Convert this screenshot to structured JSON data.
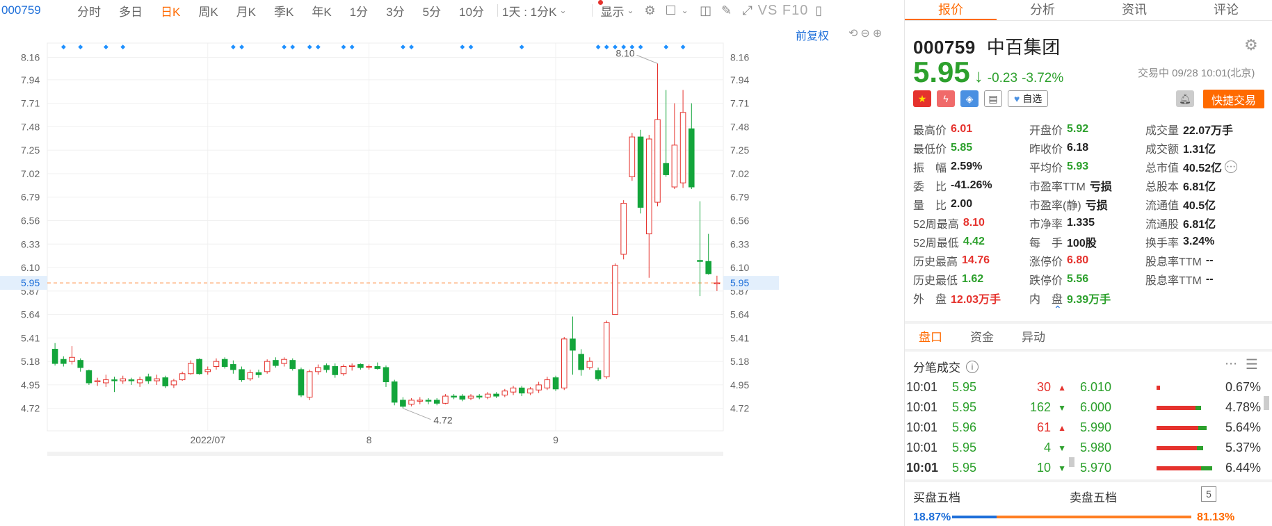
{
  "toolbar": {
    "code": "000759",
    "periods": [
      "分时",
      "多日",
      "日K",
      "周K",
      "月K",
      "季K",
      "年K",
      "1分",
      "3分",
      "5分",
      "10分"
    ],
    "active_period": "日K",
    "multi_period_select": "1天 : 1分K",
    "display_label": "显示",
    "f10_label": "VS F10"
  },
  "chart_header": {
    "adjust_label": "前复权"
  },
  "chart_data": {
    "type": "candlestick",
    "y_ticks": [
      "8.16",
      "7.94",
      "7.71",
      "7.48",
      "7.25",
      "7.02",
      "6.79",
      "6.56",
      "6.33",
      "6.10",
      "5.87",
      "5.64",
      "5.41",
      "5.18",
      "4.95",
      "4.72"
    ],
    "ylim": [
      4.5,
      8.3
    ],
    "x_labels": [
      {
        "label": "2022/07",
        "index": 18
      },
      {
        "label": "8",
        "index": 37
      },
      {
        "label": "9",
        "index": 59
      }
    ],
    "current_price": "5.95",
    "max_label": "8.10",
    "min_label": "4.72",
    "candles": [
      [
        5.3,
        5.16,
        5.36,
        5.14
      ],
      [
        5.2,
        5.16,
        5.23,
        5.13
      ],
      [
        5.18,
        5.22,
        5.33,
        5.15
      ],
      [
        5.19,
        5.12,
        5.21,
        5.08
      ],
      [
        5.09,
        4.97,
        5.1,
        4.95
      ],
      [
        4.98,
        4.99,
        5.02,
        4.94
      ],
      [
        4.97,
        5.0,
        5.05,
        4.93
      ],
      [
        5.0,
        4.99,
        5.03,
        4.88
      ],
      [
        4.99,
        5.01,
        5.04,
        4.96
      ],
      [
        5.0,
        4.99,
        5.02,
        4.95
      ],
      [
        4.97,
        5.0,
        5.03,
        4.93
      ],
      [
        5.03,
        4.99,
        5.06,
        4.96
      ],
      [
        4.99,
        5.01,
        5.05,
        4.95
      ],
      [
        5.02,
        4.94,
        5.04,
        4.92
      ],
      [
        4.95,
        4.99,
        5.01,
        4.92
      ],
      [
        5.0,
        5.06,
        5.08,
        4.99
      ],
      [
        5.06,
        5.16,
        5.19,
        5.05
      ],
      [
        5.2,
        5.06,
        5.21,
        5.05
      ],
      [
        5.08,
        5.1,
        5.13,
        5.05
      ],
      [
        5.13,
        5.18,
        5.21,
        5.1
      ],
      [
        5.2,
        5.13,
        5.22,
        5.11
      ],
      [
        5.15,
        5.1,
        5.19,
        5.06
      ],
      [
        5.1,
        5.0,
        5.13,
        4.98
      ],
      [
        5.01,
        5.07,
        5.1,
        4.99
      ],
      [
        5.07,
        5.05,
        5.1,
        5.02
      ],
      [
        5.08,
        5.18,
        5.2,
        5.06
      ],
      [
        5.19,
        5.14,
        5.22,
        5.12
      ],
      [
        5.16,
        5.2,
        5.22,
        5.13
      ],
      [
        5.19,
        5.11,
        5.21,
        5.09
      ],
      [
        5.1,
        4.85,
        5.12,
        4.83
      ],
      [
        4.83,
        5.08,
        5.1,
        4.8
      ],
      [
        5.08,
        5.12,
        5.15,
        5.05
      ],
      [
        5.14,
        5.1,
        5.16,
        5.07
      ],
      [
        5.13,
        5.05,
        5.16,
        5.02
      ],
      [
        5.06,
        5.13,
        5.15,
        5.04
      ],
      [
        5.13,
        5.14,
        5.16,
        5.09
      ],
      [
        5.15,
        5.12,
        5.16,
        5.1
      ],
      [
        5.13,
        5.13,
        5.15,
        5.1
      ],
      [
        5.13,
        5.11,
        5.17,
        5.1
      ],
      [
        5.12,
        4.98,
        5.14,
        4.93
      ],
      [
        4.98,
        4.78,
        5.0,
        4.75
      ],
      [
        4.8,
        4.74,
        4.83,
        4.72
      ],
      [
        4.76,
        4.8,
        4.82,
        4.74
      ],
      [
        4.79,
        4.8,
        4.83,
        4.76
      ],
      [
        4.8,
        4.79,
        4.82,
        4.76
      ],
      [
        4.8,
        4.77,
        4.82,
        4.75
      ],
      [
        4.77,
        4.84,
        4.86,
        4.76
      ],
      [
        4.84,
        4.83,
        4.86,
        4.81
      ],
      [
        4.84,
        4.81,
        4.86,
        4.79
      ],
      [
        4.82,
        4.84,
        4.86,
        4.8
      ],
      [
        4.84,
        4.83,
        4.86,
        4.81
      ],
      [
        4.83,
        4.86,
        4.88,
        4.81
      ],
      [
        4.86,
        4.84,
        4.88,
        4.82
      ],
      [
        4.85,
        4.89,
        4.91,
        4.83
      ],
      [
        4.88,
        4.92,
        4.94,
        4.85
      ],
      [
        4.92,
        4.87,
        4.94,
        4.84
      ],
      [
        4.87,
        4.91,
        4.93,
        4.85
      ],
      [
        4.9,
        4.95,
        4.98,
        4.87
      ],
      [
        4.92,
        5.0,
        5.03,
        4.9
      ],
      [
        5.02,
        4.91,
        5.04,
        4.89
      ],
      [
        4.92,
        5.4,
        5.42,
        4.9
      ],
      [
        5.4,
        5.29,
        5.62,
        5.05
      ],
      [
        5.25,
        5.1,
        5.3,
        5.04
      ],
      [
        5.12,
        5.18,
        5.22,
        5.1
      ],
      [
        5.09,
        5.01,
        5.12,
        4.99
      ],
      [
        5.03,
        5.56,
        5.58,
        5.01
      ],
      [
        5.64,
        6.12,
        6.14,
        5.64
      ],
      [
        6.23,
        6.73,
        6.76,
        6.18
      ],
      [
        6.99,
        7.38,
        7.42,
        6.95
      ],
      [
        7.38,
        6.69,
        7.45,
        6.63
      ],
      [
        6.43,
        7.36,
        7.4,
        6.0
      ],
      [
        6.74,
        7.55,
        8.1,
        6.7
      ],
      [
        7.12,
        7.01,
        7.84,
        6.99
      ],
      [
        6.89,
        7.3,
        7.71,
        6.87
      ],
      [
        6.93,
        7.62,
        7.84,
        6.88
      ],
      [
        7.46,
        6.89,
        7.71,
        6.87
      ],
      [
        6.17,
        6.16,
        6.75,
        5.82
      ],
      [
        6.16,
        6.04,
        6.43,
        6.03
      ],
      [
        5.94,
        5.95,
        6.02,
        5.87
      ]
    ],
    "event_markers": [
      "◆",
      "◆",
      "◆",
      "◆",
      "◆",
      "◆",
      "◆",
      "◆",
      "◆",
      "◆",
      "◆",
      "◆",
      "◆",
      "◆",
      "◆",
      "◆",
      "◆",
      "◆",
      "◆",
      "◆",
      "◆",
      "◆",
      "◆",
      "◆",
      "◆"
    ],
    "colors": {
      "up": "#e5322d",
      "down": "#13a53b",
      "price_line": "#ff8a3d",
      "marker": "#1e90ff"
    }
  },
  "panel": {
    "tabs": [
      "报价",
      "分析",
      "资讯",
      "评论"
    ],
    "active_tab": "报价",
    "stock_code": "000759",
    "stock_name": "中百集团",
    "price": "5.95",
    "change": "-0.23",
    "change_pct": "-3.72%",
    "trade_status": "交易中 09/28 10:01(北京)",
    "watch_label": "自选",
    "fast_trade_label": "快捷交易",
    "stats": [
      {
        "k": "最高价",
        "v": "6.01",
        "c": "red"
      },
      {
        "k": "开盘价",
        "v": "5.92",
        "c": "green"
      },
      {
        "k": "成交量",
        "v": "22.07万手",
        "c": ""
      },
      {
        "k": "最低价",
        "v": "5.85",
        "c": "green"
      },
      {
        "k": "昨收价",
        "v": "6.18",
        "c": ""
      },
      {
        "k": "成交额",
        "v": "1.31亿",
        "c": ""
      },
      {
        "k": "振　幅",
        "v": "2.59%",
        "c": ""
      },
      {
        "k": "平均价",
        "v": "5.93",
        "c": "green"
      },
      {
        "k": "总市值",
        "v": "40.52亿",
        "c": ""
      },
      {
        "k": "委　比",
        "v": "-41.26%",
        "c": ""
      },
      {
        "k": "市盈率TTM",
        "v": "亏损",
        "c": ""
      },
      {
        "k": "总股本",
        "v": "6.81亿",
        "c": ""
      },
      {
        "k": "量　比",
        "v": "2.00",
        "c": ""
      },
      {
        "k": "市盈率(静)",
        "v": "亏损",
        "c": ""
      },
      {
        "k": "流通值",
        "v": "40.5亿",
        "c": ""
      },
      {
        "k": "52周最高",
        "v": "8.10",
        "c": "red"
      },
      {
        "k": "市净率",
        "v": "1.335",
        "c": ""
      },
      {
        "k": "流通股",
        "v": "6.81亿",
        "c": ""
      },
      {
        "k": "52周最低",
        "v": "4.42",
        "c": "green"
      },
      {
        "k": "每　手",
        "v": "100股",
        "c": ""
      },
      {
        "k": "换手率",
        "v": "3.24%",
        "c": ""
      },
      {
        "k": "历史最高",
        "v": "14.76",
        "c": "red"
      },
      {
        "k": "涨停价",
        "v": "6.80",
        "c": "red"
      },
      {
        "k": "股息率TTM",
        "v": "--",
        "c": ""
      },
      {
        "k": "历史最低",
        "v": "1.62",
        "c": "green"
      },
      {
        "k": "跌停价",
        "v": "5.56",
        "c": "green"
      },
      {
        "k": "股息率TTM",
        "v": "--",
        "c": ""
      },
      {
        "k": "外　盘",
        "v": "12.03万手",
        "c": "red"
      },
      {
        "k": "内　盘",
        "v": "9.39万手",
        "c": "green"
      }
    ],
    "sub_tabs": [
      "盘口",
      "资金",
      "异动"
    ],
    "active_sub_tab": "盘口",
    "tick_title": "分笔成交",
    "ticks": [
      {
        "t": "10:01",
        "p": "5.95",
        "vol": "30",
        "dir": "up"
      },
      {
        "t": "10:01",
        "p": "5.95",
        "vol": "162",
        "dir": "down"
      },
      {
        "t": "10:01",
        "p": "5.96",
        "vol": "61",
        "dir": "up"
      },
      {
        "t": "10:01",
        "p": "5.95",
        "vol": "4",
        "dir": "down"
      },
      {
        "t": "10:01",
        "p": "5.95",
        "vol": "10",
        "dir": "down"
      }
    ],
    "depth": [
      {
        "p": "6.010",
        "red": 0.06,
        "green": 0.0,
        "pct": "0.67%"
      },
      {
        "p": "6.000",
        "red": 0.7,
        "green": 0.1,
        "pct": "4.78%"
      },
      {
        "p": "5.990",
        "red": 0.75,
        "green": 0.15,
        "pct": "5.64%"
      },
      {
        "p": "5.980",
        "red": 0.72,
        "green": 0.12,
        "pct": "5.37%"
      },
      {
        "p": "5.970",
        "red": 0.8,
        "green": 0.2,
        "pct": "6.44%"
      }
    ],
    "buy5_label": "买盘五档",
    "sell5_label": "卖盘五档",
    "five_count": "5",
    "buy_ratio": "18.87%",
    "sell_ratio": "81.13%"
  }
}
